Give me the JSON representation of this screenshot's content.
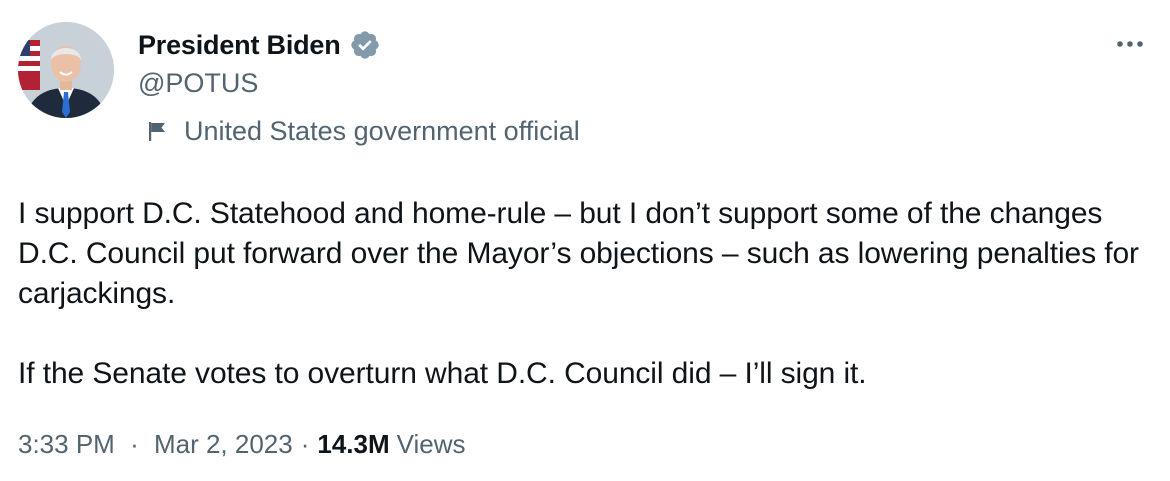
{
  "author": {
    "display_name": "President Biden",
    "handle": "@POTUS",
    "verified_badge_color": "#829aab",
    "affiliation_label": "United States government official",
    "affiliation_icon": "flag-icon",
    "avatar_icon": "avatar-photo"
  },
  "more_icon": "more-horizontal-icon",
  "tweet": {
    "paragraphs": [
      "I support D.C. Statehood and home-rule – but I don’t support some of the changes D.C. Council put forward over the Mayor’s objections – such as lowering penalties for carjackings.",
      "If the Senate votes to overturn what D.C. Council did – I’ll sign it."
    ]
  },
  "meta": {
    "time": "3:33 PM",
    "separator": "·",
    "date": "Mar 2, 2023",
    "views_count": "14.3M",
    "views_label": "Views"
  },
  "colors": {
    "text_primary": "#0f1419",
    "text_secondary": "#536471",
    "background": "#ffffff"
  }
}
